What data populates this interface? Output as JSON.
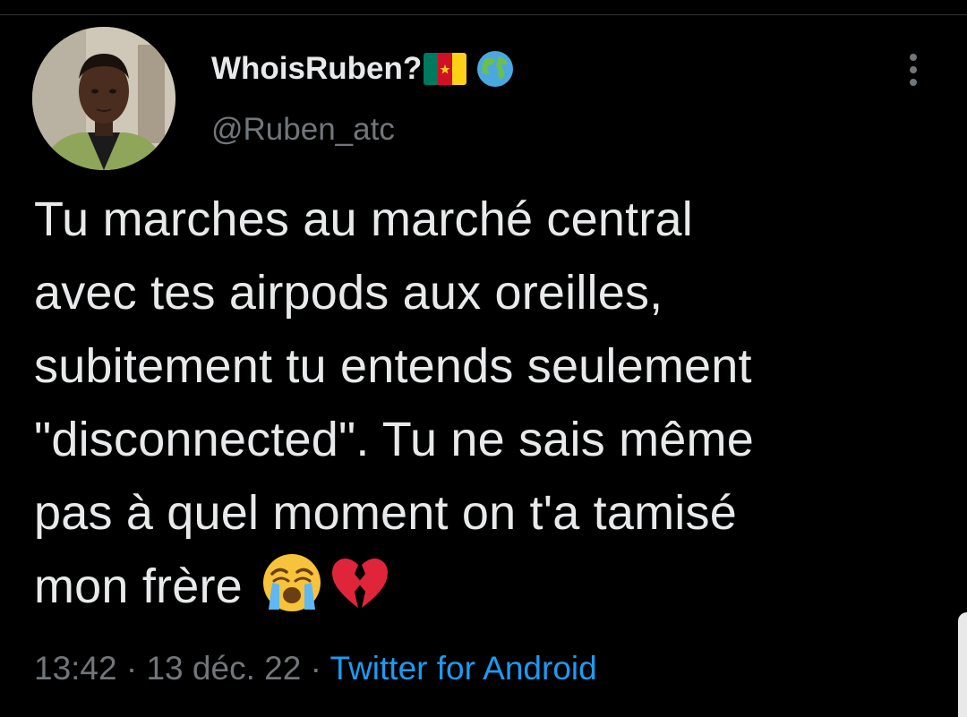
{
  "author": {
    "display_name": "WhoisRuben?",
    "handle": "@Ruben_atc",
    "flag_colors": [
      "#007a5e",
      "#ce1126",
      "#fcd116"
    ],
    "badges": [
      "cameroon-flag-icon",
      "globe-icon"
    ]
  },
  "tweet": {
    "lines": [
      "Tu marches au marché central",
      "avec tes airpods aux oreilles,",
      "subitement tu entends seulement",
      "\"disconnected\". Tu ne sais même",
      "pas à quel moment on t'a tamisé",
      "mon frère"
    ],
    "emojis": [
      "crying-face-icon",
      "broken-heart-icon"
    ]
  },
  "meta": {
    "time": "13:42",
    "separator": " · ",
    "date": "13 déc. 22",
    "source": "Twitter for Android"
  },
  "colors": {
    "background": "#000000",
    "text": "#e7e9ea",
    "muted": "#71767b",
    "link": "#1d9bf0"
  }
}
